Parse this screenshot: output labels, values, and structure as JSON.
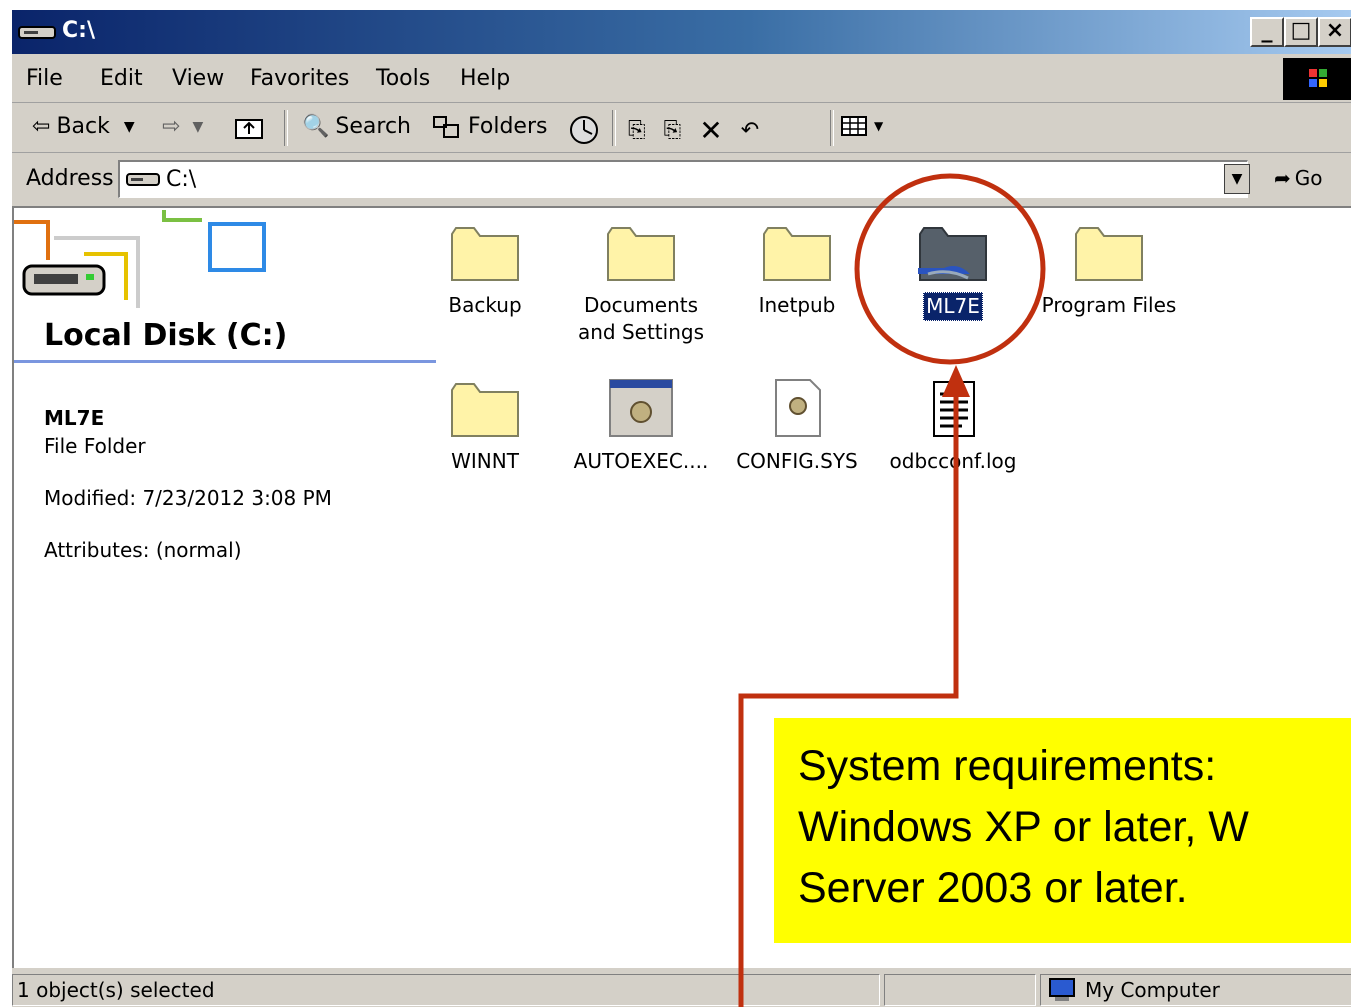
{
  "window": {
    "title": "C:\\",
    "min": "_",
    "max": "□",
    "close": "×"
  },
  "menubar": {
    "items": [
      "File",
      "Edit",
      "View",
      "Favorites",
      "Tools",
      "Help"
    ]
  },
  "toolbar": {
    "back": "Back",
    "search": "Search",
    "folders": "Folders"
  },
  "address": {
    "label": "Address",
    "value": "C:\\",
    "go": "Go"
  },
  "webview": {
    "title": "Local Disk (C:)",
    "selected_name": "ML7E",
    "selected_type": "File Folder",
    "modified": "Modified: 7/23/2012 3:08 PM",
    "attributes": "Attributes: (normal)"
  },
  "files": [
    {
      "name": "Backup",
      "kind": "folder"
    },
    {
      "name": "Documents and Settings",
      "kind": "folder"
    },
    {
      "name": "Inetpub",
      "kind": "folder"
    },
    {
      "name": "ML7E",
      "kind": "shared-folder",
      "selected": true
    },
    {
      "name": "Program Files",
      "kind": "folder"
    },
    {
      "name": "WINNT",
      "kind": "folder"
    },
    {
      "name": "AUTOEXEC....",
      "kind": "sysfile"
    },
    {
      "name": "CONFIG.SYS",
      "kind": "config"
    },
    {
      "name": "odbcconf.log",
      "kind": "log"
    }
  ],
  "status": {
    "selection": "1 object(s) selected",
    "zone": "My Computer"
  },
  "callout": {
    "line1": "System requirements:",
    "line2": "Windows XP or later, W",
    "line3": "Server 2003 or later."
  },
  "colors": {
    "titlebar": "#0a246a",
    "annotation": "#c0300f",
    "callout_bg": "#ffff00",
    "selection": "#0a246a"
  }
}
